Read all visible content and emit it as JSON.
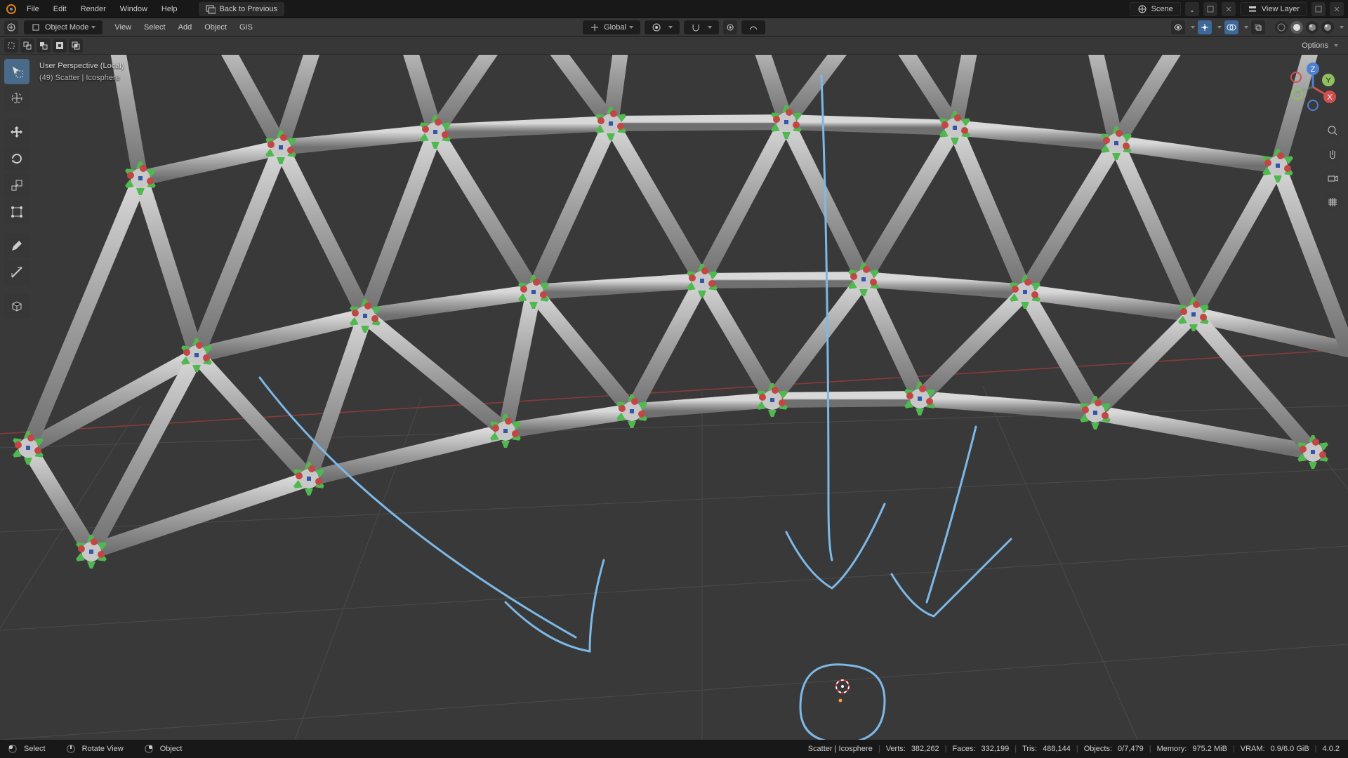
{
  "app": "Blender",
  "topbar": {
    "menus": [
      "File",
      "Edit",
      "Render",
      "Window",
      "Help"
    ],
    "back_label": "Back to Previous",
    "scene_label": "Scene",
    "viewlayer_label": "View Layer"
  },
  "header": {
    "mode_label": "Object Mode",
    "menus": [
      "View",
      "Select",
      "Add",
      "Object",
      "GIS"
    ],
    "orientation_label": "Global"
  },
  "subheader": {
    "options_label": "Options"
  },
  "overlay": {
    "line1": "User Perspective (Local)",
    "line2": "(49) Scatter | Icosphere"
  },
  "tools": {
    "left": [
      "select-box",
      "cursor",
      "move",
      "rotate",
      "scale",
      "transform",
      "annotate",
      "measure",
      "add-cube"
    ]
  },
  "gizmo": {
    "axes": {
      "x": "X",
      "y": "Y",
      "z": "Z"
    }
  },
  "statusbar": {
    "select_label": "Select",
    "rotate_label": "Rotate View",
    "object_label": "Object",
    "info": {
      "context": "Scatter | Icosphere",
      "verts_label": "Verts:",
      "verts": "382,262",
      "faces_label": "Faces:",
      "faces": "332,199",
      "tris_label": "Tris:",
      "tris": "488,144",
      "objects_label": "Objects:",
      "objects": "0/7,479",
      "memory_label": "Memory:",
      "memory": "975.2 MiB",
      "vram_label": "VRAM:",
      "vram": "0.9/6.0 GiB",
      "version": "4.0.2"
    }
  },
  "colors": {
    "bg_viewport": "#393939",
    "accent": "#4a6a8a",
    "strut": "#b5b5b5",
    "connector_green": "#4fb84f",
    "connector_red": "#c44545",
    "annotation": "#7db9e8"
  }
}
